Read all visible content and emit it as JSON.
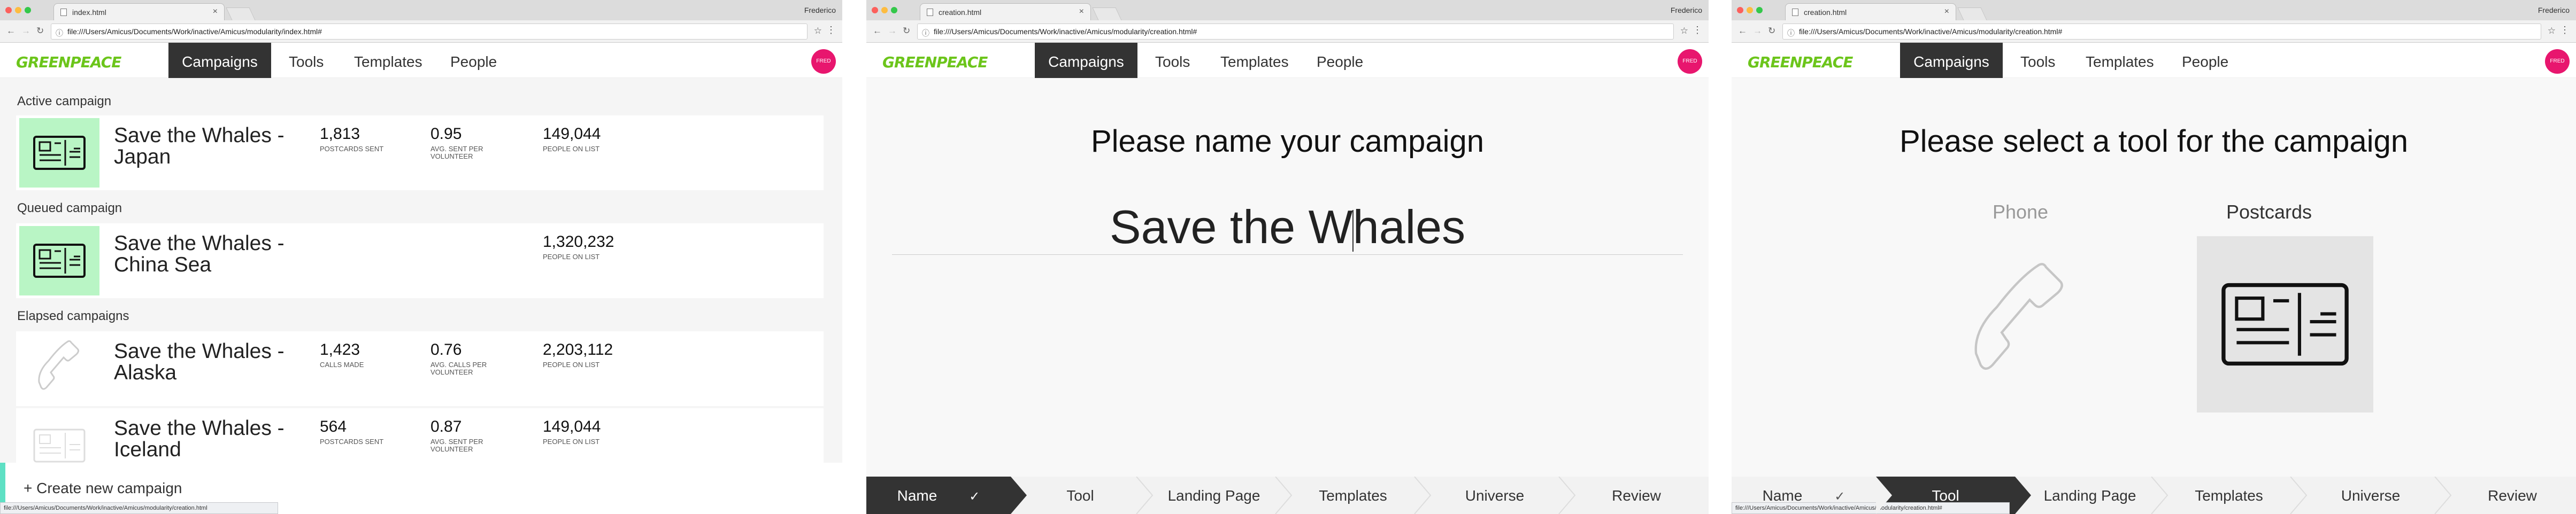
{
  "user_name": "Frederico",
  "colors": {
    "brand_green": "#6cc51b",
    "accent_pink": "#e8166e",
    "dark_nav": "#333333",
    "mint": "#5ee0c4",
    "thumb_green": "#b9f5c5"
  },
  "nav": {
    "campaigns": "Campaigns",
    "tools": "Tools",
    "templates": "Templates",
    "people": "People"
  },
  "logo_text": "GREENPEACE",
  "avatar_text": "FRED",
  "win1": {
    "tab_title": "index.html",
    "url": "file:///Users/Amicus/Documents/Work/inactive/Amicus/modularity/index.html#",
    "sections": {
      "active": "Active campaign",
      "queued": "Queued campaign",
      "elapsed": "Elapsed campaigns"
    },
    "campaigns": [
      {
        "title": "Save the Whales - Japan",
        "tool_icon": "postcard-icon",
        "stats": [
          {
            "value": "1,813",
            "label": "POSTCARDS SENT"
          },
          {
            "value": "0.95",
            "label": "AVG. SENT PER VOLUNTEER"
          },
          {
            "value": "149,044",
            "label": "PEOPLE ON LIST"
          }
        ]
      },
      {
        "title": "Save the Whales - China Sea",
        "tool_icon": "postcard-icon",
        "stats": [
          {
            "value": "1,320,232",
            "label": "PEOPLE ON LIST"
          }
        ]
      },
      {
        "title": "Save the Whales - Alaska",
        "tool_icon": "phone-icon",
        "stats": [
          {
            "value": "1,423",
            "label": "CALLS MADE"
          },
          {
            "value": "0.76",
            "label": "AVG. CALLS PER VOLUNTEER"
          },
          {
            "value": "2,203,112",
            "label": "PEOPLE ON LIST"
          }
        ]
      },
      {
        "title": "Save the Whales - Iceland",
        "tool_icon": "postcard-icon",
        "stats": [
          {
            "value": "564",
            "label": "POSTCARDS SENT"
          },
          {
            "value": "0.87",
            "label": "AVG. SENT PER VOLUNTEER"
          },
          {
            "value": "149,044",
            "label": "PEOPLE ON LIST"
          }
        ]
      }
    ],
    "create_label": "+ Create new campaign",
    "status_url": "file:///Users/Amicus/Documents/Work/inactive/Amicus/modularity/creation.html"
  },
  "win2": {
    "tab_title": "creation.html",
    "url": "file:///Users/Amicus/Documents/Work/inactive/Amicus/modularity/creation.html#",
    "heading": "Please name your campaign",
    "name_before_cursor": "Save the W",
    "name_after_cursor": "hales"
  },
  "win3": {
    "tab_title": "creation.html",
    "url": "file:///Users/Amicus/Documents/Work/inactive/Amicus/modularity/creation.html#",
    "heading": "Please select a tool for the campaign",
    "tools": [
      {
        "label": "Phone",
        "icon": "phone-icon",
        "selected": false
      },
      {
        "label": "Postcards",
        "icon": "postcard-icon",
        "selected": true
      }
    ],
    "status_url": "file:///Users/Amicus/Documents/Work/inactive/Amicus/modularity/creation.html#"
  },
  "steps": [
    "Name",
    "Tool",
    "Landing Page",
    "Templates",
    "Universe",
    "Review"
  ],
  "steps_checkmark": "✓"
}
